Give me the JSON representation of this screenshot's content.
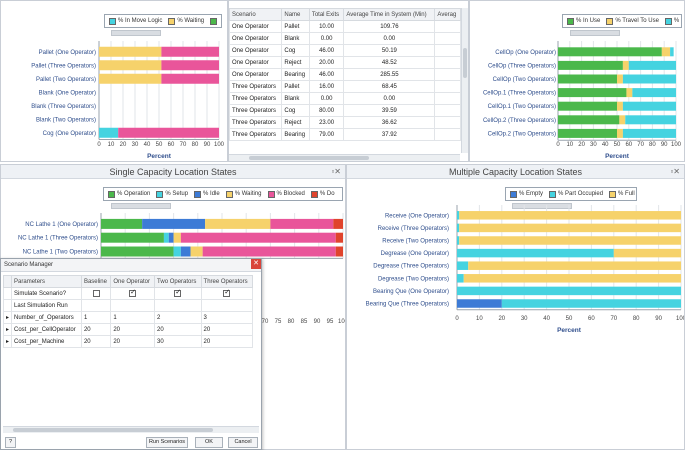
{
  "colors": {
    "green": "#4bb84b",
    "blue": "#3d7bd6",
    "yellow": "#f6d26b",
    "pink": "#e9559a",
    "cyan": "#45d3e0",
    "red": "#e0442d",
    "white": "#ffffff",
    "grid": "#e2e5e9"
  },
  "panel1": {
    "legend": [
      {
        "label": "% In Move Logic",
        "color": "#45d3e0"
      },
      {
        "label": "% Waiting",
        "color": "#f6d26b"
      },
      {
        "label": "",
        "color": "#4bb84b"
      }
    ]
  },
  "panel2": {
    "columns": [
      "Scenario",
      "Name",
      "Total Exits",
      "Average Time in System (Min)",
      "Averag"
    ],
    "rows": [
      [
        "One Operator",
        "Pallet",
        "10.00",
        "109.76",
        ""
      ],
      [
        "One Operator",
        "Blank",
        "0.00",
        "0.00",
        ""
      ],
      [
        "One Operator",
        "Cog",
        "46.00",
        "50.19",
        ""
      ],
      [
        "One Operator",
        "Reject",
        "20.00",
        "48.52",
        ""
      ],
      [
        "One Operator",
        "Bearing",
        "46.00",
        "285.55",
        ""
      ],
      [
        "Three Operators",
        "Pallet",
        "16.00",
        "68.45",
        ""
      ],
      [
        "Three Operators",
        "Blank",
        "0.00",
        "0.00",
        ""
      ],
      [
        "Three Operators",
        "Cog",
        "80.00",
        "39.59",
        ""
      ],
      [
        "Three Operators",
        "Reject",
        "23.00",
        "36.62",
        ""
      ],
      [
        "Three Operators",
        "Bearing",
        "79.00",
        "37.92",
        ""
      ]
    ]
  },
  "panel3": {
    "legend": [
      {
        "label": "% In Use",
        "color": "#4bb84b"
      },
      {
        "label": "% Travel To Use",
        "color": "#f6d26b"
      },
      {
        "label": "% T",
        "color": "#45d3e0"
      }
    ]
  },
  "panel4": {
    "title": "Single Capacity Location States",
    "close": "▫✕",
    "legend": [
      {
        "label": "% Operation",
        "color": "#4bb84b"
      },
      {
        "label": "% Setup",
        "color": "#45d3e0"
      },
      {
        "label": "% Idle",
        "color": "#3d7bd6"
      },
      {
        "label": "% Waiting",
        "color": "#f6d26b"
      },
      {
        "label": "% Blocked",
        "color": "#e9559a"
      },
      {
        "label": "% Do",
        "color": "#e0442d"
      }
    ]
  },
  "panel5": {
    "title": "Multiple Capacity Location States",
    "close": "▫✕",
    "legend": [
      {
        "label": "% Empty",
        "color": "#3d7bd6"
      },
      {
        "label": "% Part Occupied",
        "color": "#45d3e0"
      },
      {
        "label": "% Full",
        "color": "#f6d26b"
      }
    ]
  },
  "dialog": {
    "title": "Scenario Manager",
    "close": "✕",
    "columns": [
      "Parameters",
      "Baseline",
      "One Operator",
      "Two Operators",
      "Three Operators"
    ],
    "rows": [
      {
        "marker": "",
        "label": "Simulate Scenario?",
        "values": [
          "",
          "",
          "",
          ""
        ],
        "checks": [
          false,
          true,
          true,
          true
        ]
      },
      {
        "marker": "",
        "label": "Last Simulation Run",
        "values": [
          "",
          "",
          "",
          ""
        ],
        "checks": null
      },
      {
        "marker": "▸",
        "label": "Number_of_Operators",
        "values": [
          "1",
          "1",
          "2",
          "3"
        ],
        "checks": null
      },
      {
        "marker": "▸",
        "label": "Cost_per_CellOperator",
        "values": [
          "20",
          "20",
          "20",
          "20"
        ],
        "checks": null
      },
      {
        "marker": "▸",
        "label": "Cost_per_Machine",
        "values": [
          "20",
          "20",
          "30",
          "20"
        ],
        "checks": null
      }
    ],
    "run_label": "Run Scenarios",
    "ok_label": "OK",
    "cancel_label": "Cancel",
    "help_icon": "?"
  },
  "chart_data": [
    {
      "type": "bar",
      "orientation": "horizontal",
      "stacked": true,
      "xlabel": "Percent",
      "xlim": [
        0,
        100
      ],
      "xticks": [
        0,
        10,
        20,
        30,
        40,
        50,
        60,
        70,
        80,
        90,
        100
      ],
      "categories": [
        "Pallet (One Operator)",
        "Pallet (Three Operators)",
        "Pallet (Two Operators)",
        "Blank (One Operator)",
        "Blank (Three Operators)",
        "Blank (Two Operators)",
        "Cog (One Operator)"
      ],
      "series": [
        {
          "name": "% In Move Logic",
          "color": "#45d3e0",
          "values": [
            0,
            0,
            0,
            0,
            0,
            0,
            16
          ]
        },
        {
          "name": "% Waiting",
          "color": "#f6d26b",
          "values": [
            52,
            52,
            52,
            0,
            0,
            0,
            0
          ]
        },
        {
          "name": "",
          "color": "#4bb84b",
          "values": [
            0,
            0,
            0,
            0,
            0,
            0,
            0
          ]
        },
        {
          "name": "",
          "color": "#e9559a",
          "values": [
            48,
            48,
            48,
            0,
            0,
            0,
            84
          ]
        }
      ]
    },
    {
      "type": "bar",
      "orientation": "horizontal",
      "stacked": true,
      "xlabel": "Percent",
      "xlim": [
        0,
        100
      ],
      "xticks": [
        0,
        10,
        20,
        30,
        40,
        50,
        60,
        70,
        80,
        90,
        100
      ],
      "categories": [
        "CellOp (One Operator)",
        "CellOp (Three Operators)",
        "CellOp (Two Operators)",
        "CellOp.1 (Three Operators)",
        "CellOp.1 (Two Operators)",
        "CellOp.2 (Three Operators)",
        "CellOp.2 (Two Operators)"
      ],
      "series": [
        {
          "name": "% In Use",
          "color": "#4bb84b",
          "values": [
            88,
            55,
            50,
            58,
            50,
            52,
            50
          ]
        },
        {
          "name": "% Travel To Use",
          "color": "#f6d26b",
          "values": [
            7,
            5,
            5,
            5,
            5,
            5,
            5
          ]
        },
        {
          "name": "% T",
          "color": "#45d3e0",
          "values": [
            3,
            40,
            45,
            37,
            45,
            43,
            45
          ]
        }
      ]
    },
    {
      "type": "bar",
      "orientation": "horizontal",
      "stacked": true,
      "xlim": [
        0,
        100
      ],
      "xticks": [
        70,
        75,
        80,
        85,
        90,
        95,
        100
      ],
      "categories": [
        "NC Lathe 1 (One Operator)",
        "NC Lathe 1 (Three Operators)",
        "NC Lathe 1 (Two Operators)"
      ],
      "series": [
        {
          "name": "% Operation",
          "color": "#4bb84b",
          "values": [
            17,
            26,
            30
          ]
        },
        {
          "name": "% Setup",
          "color": "#45d3e0",
          "values": [
            0,
            2,
            3
          ]
        },
        {
          "name": "% Idle",
          "color": "#3d7bd6",
          "values": [
            26,
            2,
            4
          ]
        },
        {
          "name": "% Waiting",
          "color": "#f6d26b",
          "values": [
            27,
            3,
            5
          ]
        },
        {
          "name": "% Blocked",
          "color": "#e9559a",
          "values": [
            26,
            64,
            55
          ]
        },
        {
          "name": "% Do",
          "color": "#e0442d",
          "values": [
            4,
            3,
            3
          ]
        }
      ]
    },
    {
      "type": "bar",
      "orientation": "horizontal",
      "stacked": true,
      "xlabel": "Percent",
      "xlim": [
        0,
        100
      ],
      "xticks": [
        0,
        10,
        20,
        30,
        40,
        50,
        60,
        70,
        80,
        90,
        100
      ],
      "categories": [
        "Receive (One Operator)",
        "Receive (Three Operators)",
        "Receive (Two Operators)",
        "Degrease (One Operator)",
        "Degrease (Three Operators)",
        "Degrease (Two Operators)",
        "Bearing Que (One Operator)",
        "Bearing Que (Three Operators)"
      ],
      "series": [
        {
          "name": "% Empty",
          "color": "#3d7bd6",
          "values": [
            0,
            0,
            0,
            0,
            0,
            0,
            0,
            20
          ]
        },
        {
          "name": "% Part Occupied",
          "color": "#45d3e0",
          "values": [
            1,
            1,
            1,
            70,
            5,
            3,
            100,
            80
          ]
        },
        {
          "name": "% Full",
          "color": "#f6d26b",
          "values": [
            99,
            99,
            99,
            30,
            95,
            97,
            0,
            0
          ]
        }
      ]
    }
  ]
}
